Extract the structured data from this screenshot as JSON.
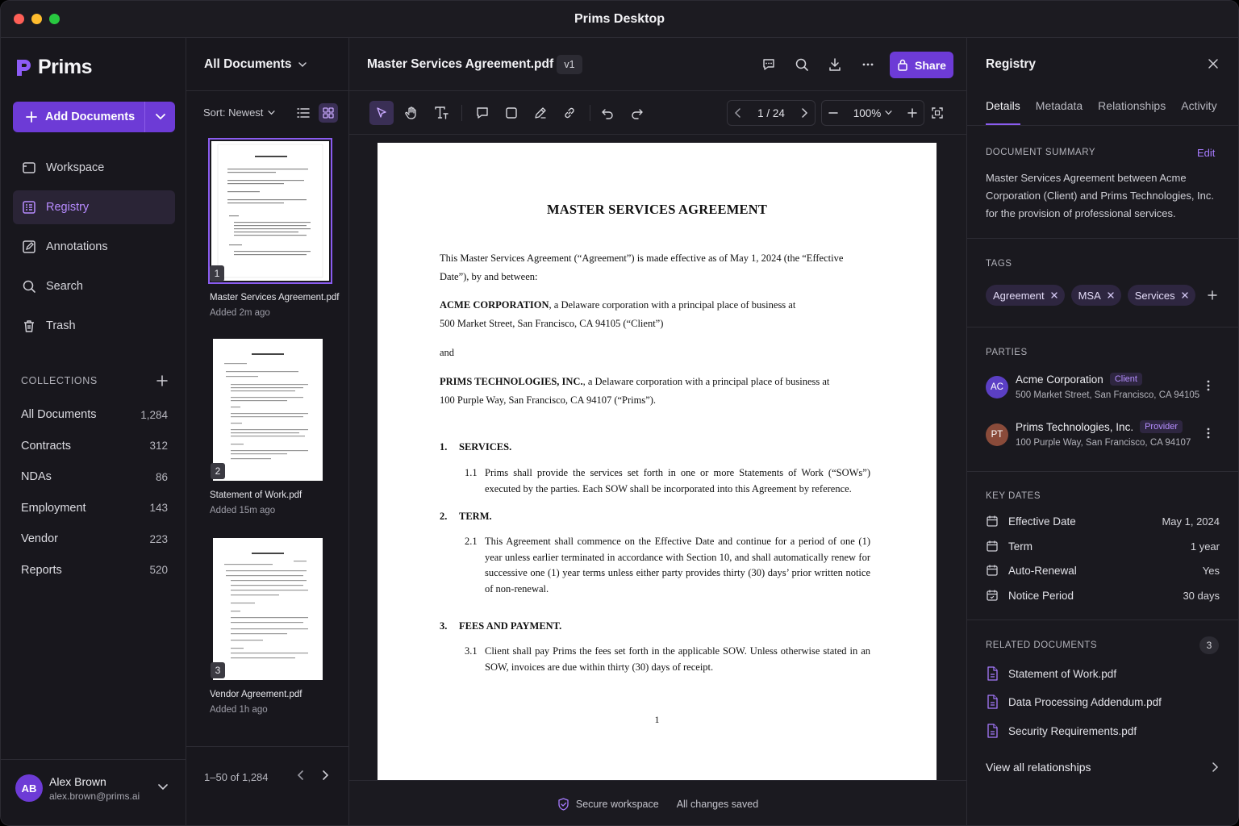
{
  "app": {
    "window_title": "Prims Desktop",
    "logo_text": "Prims"
  },
  "sidebar": {
    "add_button_label": "Add Documents",
    "nav": [
      {
        "label": "Workspace",
        "icon": "workspace-icon"
      },
      {
        "label": "Registry",
        "icon": "registry-icon",
        "active": true
      },
      {
        "label": "Annotations",
        "icon": "annotations-icon"
      },
      {
        "label": "Search",
        "icon": "search-icon"
      },
      {
        "label": "Trash",
        "icon": "trash-icon"
      }
    ],
    "collections_heading": "COLLECTIONS",
    "collections": [
      {
        "label": "All Documents",
        "count": "1,284"
      },
      {
        "label": "Contracts",
        "count": "312"
      },
      {
        "label": "NDAs",
        "count": "86"
      },
      {
        "label": "Employment",
        "count": "143"
      },
      {
        "label": "Vendor",
        "count": "223"
      },
      {
        "label": "Reports",
        "count": "520"
      }
    ],
    "user": {
      "initials": "AB",
      "name": "Alex Brown",
      "email": "alex.brown@prims.ai"
    }
  },
  "doclist": {
    "title": "All Documents",
    "sort_label": "Sort: Newest",
    "items": [
      {
        "num": "1",
        "name": "Master Services Agreement.pdf",
        "meta": "Added 2m ago",
        "selected": true
      },
      {
        "num": "2",
        "name": "Statement of Work.pdf",
        "meta": "Added 15m ago"
      },
      {
        "num": "3",
        "name": "Vendor Agreement.pdf",
        "meta": "Added 1h ago"
      }
    ],
    "range": "1–50 of 1,284"
  },
  "viewer": {
    "file_name": "Master Services Agreement.pdf",
    "version": "v1",
    "share_label": "Share",
    "page_indicator": "1 / 24",
    "zoom": "100%",
    "document": {
      "title": "MASTER SERVICES AGREEMENT",
      "intro": "This Master Services Agreement (“Agreement”) is made effective as of May 1, 2024 (the “Effective Date”), by and between:",
      "party1_name": "ACME CORPORATION",
      "party1_rest": ", a Delaware corporation with a principal place of business at",
      "party1_addr": "500 Market Street, San Francisco, CA 94105 (“Client”)",
      "and": "and",
      "party2_name": "PRIMS TECHNOLOGIES, INC.",
      "party2_rest": ", a Delaware corporation with a principal place of business at",
      "party2_addr": "100 Purple Way, San Francisco, CA 94107 (“Prims”).",
      "sections": [
        {
          "num": "1.",
          "title": "SERVICES.",
          "sub_num": "1.1",
          "sub_text": "Prims shall provide the services set forth in one or more Statements of Work (“SOWs”) executed by the parties. Each SOW shall be incorporated into this Agreement by reference."
        },
        {
          "num": "2.",
          "title": "TERM.",
          "sub_num": "2.1",
          "sub_text": "This Agreement shall commence on the Effective Date and continue for a period of one (1) year unless earlier terminated in accordance with Section 10, and shall automatically renew for successive one (1) year terms unless either party provides thirty (30) days’ prior written notice of non-renewal."
        },
        {
          "num": "3.",
          "title": "FEES AND PAYMENT.",
          "sub_num": "3.1",
          "sub_text": "Client shall pay Prims the fees set forth in the applicable SOW. Unless otherwise stated in an SOW, invoices are due within thirty (30) days of receipt."
        }
      ],
      "page_number": "1"
    },
    "status_secure": "Secure workspace",
    "status_saved": "All changes saved"
  },
  "panel": {
    "title": "Registry",
    "tabs": [
      "Details",
      "Metadata",
      "Relationships",
      "Activity"
    ],
    "summary_label": "DOCUMENT SUMMARY",
    "edit_label": "Edit",
    "summary": "Master Services Agreement between Acme Corporation (Client) and Prims Technologies, Inc. for the provision of professional services.",
    "tags_label": "TAGS",
    "tags": [
      "Agreement",
      "MSA",
      "Services"
    ],
    "parties_label": "PARTIES",
    "parties": [
      {
        "initials": "AC",
        "name": "Acme Corporation",
        "role": "Client",
        "address": "500 Market Street, San Francisco, CA 94105",
        "color": "#5b3fc4"
      },
      {
        "initials": "PT",
        "name": "Prims Technologies, Inc.",
        "role": "Provider",
        "address": "100 Purple Way, San Francisco, CA 94107",
        "color": "#8a4b3a"
      }
    ],
    "key_dates_label": "KEY DATES",
    "key_dates": [
      {
        "label": "Effective Date",
        "value": "May 1, 2024"
      },
      {
        "label": "Term",
        "value": "1 year"
      },
      {
        "label": "Auto-Renewal",
        "value": "Yes"
      },
      {
        "label": "Notice Period",
        "value": "30 days"
      }
    ],
    "related_label": "RELATED DOCUMENTS",
    "related_count": "3",
    "related": [
      "Statement of Work.pdf",
      "Data Processing Addendum.pdf",
      "Security Requirements.pdf"
    ],
    "view_all": "View all relationships"
  },
  "colors": {
    "accent": "#6d3bd6",
    "accent_light": "#a77bff",
    "background": "#17161c"
  }
}
